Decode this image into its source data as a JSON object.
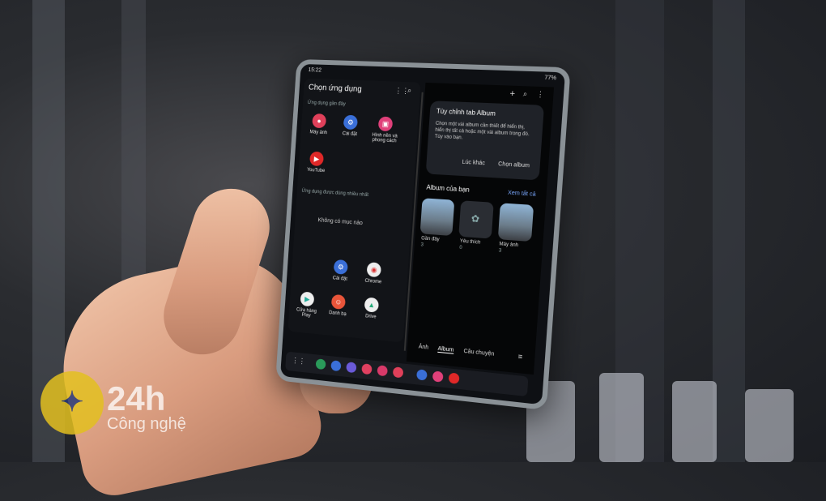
{
  "status": {
    "time": "15:22",
    "battery": "77%"
  },
  "left": {
    "title": "Chọn ứng dụng",
    "recent_header": "Ứng dụng gần đây",
    "recent_apps": [
      "Máy ảnh",
      "Cài đặt",
      "Hình nền và phong cách",
      "YouTube"
    ],
    "most_used_header": "Ứng dụng được dùng nhiều nhất",
    "empty": "Không có mục nào",
    "grid_apps": [
      "Cài đặt",
      "Chrome",
      "Cửa hàng Play",
      "Danh bạ",
      "Drive"
    ]
  },
  "right": {
    "card_title": "Tùy chỉnh tab Album",
    "card_text": "Chọn một vài album cần thiết để hiển thị, hiển thị tất cả hoặc một vài album trong đó. Tùy vào bạn.",
    "btn_later": "Lúc khác",
    "btn_choose": "Chọn album",
    "albums_header": "Album của bạn",
    "see_all": "Xem tất cả",
    "albums": [
      {
        "name": "Gần đây",
        "count": "3"
      },
      {
        "name": "Yêu thích",
        "count": "0"
      },
      {
        "name": "Máy ảnh",
        "count": "3"
      }
    ],
    "tabs": [
      "Ảnh",
      "Album",
      "Câu chuyện"
    ]
  },
  "watermark": {
    "brand": "24h",
    "sub": "Công nghệ"
  }
}
